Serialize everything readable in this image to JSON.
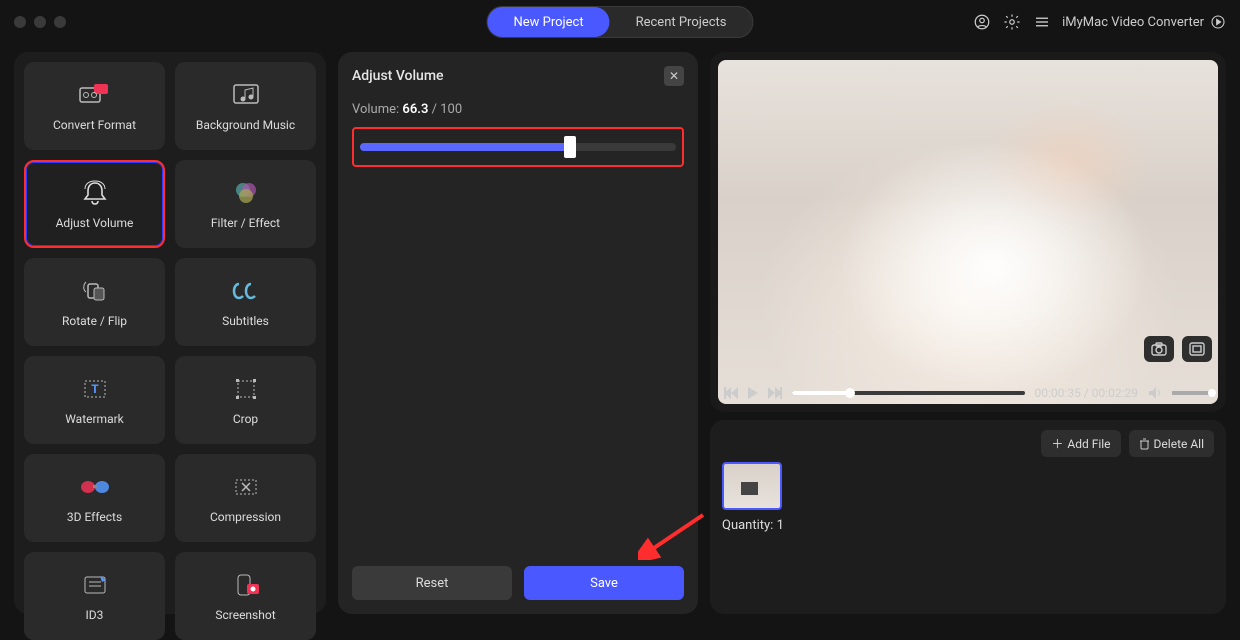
{
  "app_name": "iMyMac Video Converter",
  "tabs": {
    "new_project": "New Project",
    "recent_projects": "Recent Projects"
  },
  "sidebar": {
    "items": [
      {
        "label": "Convert Format"
      },
      {
        "label": "Background Music"
      },
      {
        "label": "Adjust Volume"
      },
      {
        "label": "Filter / Effect"
      },
      {
        "label": "Rotate / Flip"
      },
      {
        "label": "Subtitles"
      },
      {
        "label": "Watermark"
      },
      {
        "label": "Crop"
      },
      {
        "label": "3D Effects"
      },
      {
        "label": "Compression"
      },
      {
        "label": "ID3"
      },
      {
        "label": "Screenshot"
      }
    ]
  },
  "panel": {
    "title": "Adjust Volume",
    "volume_prefix": "Volume: ",
    "volume_value": "66.3",
    "volume_max_suffix": " / 100",
    "slider_percent": 66.3,
    "reset": "Reset",
    "save": "Save"
  },
  "player": {
    "current": "00:00:35",
    "total": "00:02:29",
    "separator": " / ",
    "progress_percent": 25
  },
  "files": {
    "add_file": "Add File",
    "delete_all": "Delete All",
    "quantity_label": "Quantity: ",
    "quantity_value": "1"
  }
}
